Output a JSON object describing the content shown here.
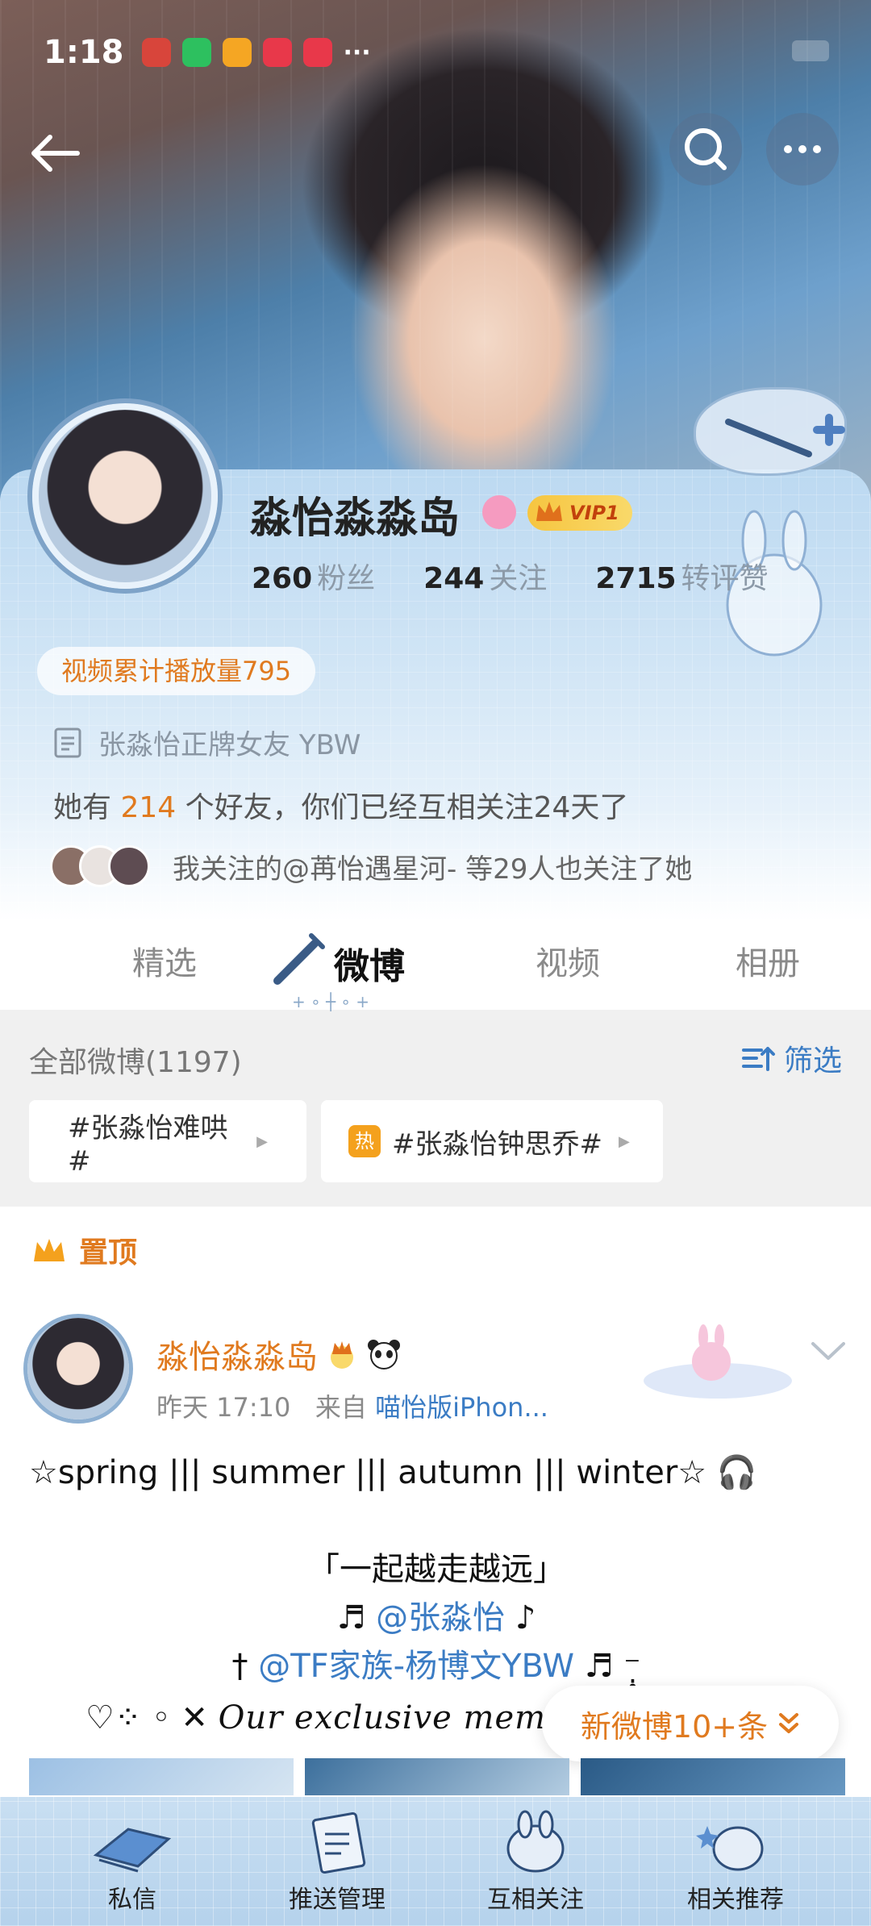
{
  "status_bar": {
    "time": "1:18",
    "more": "···"
  },
  "profile": {
    "nickname": "淼怡淼淼岛",
    "vip_label": "VIP1",
    "stats": [
      {
        "value": "260",
        "label": "粉丝"
      },
      {
        "value": "244",
        "label": "关注"
      },
      {
        "value": "2715",
        "label": "转评赞"
      }
    ],
    "play_count": "视频累计播放量795",
    "bio": "张淼怡正牌女友 YBW",
    "friends": {
      "prefix": "她有 ",
      "count": "214",
      "suffix": " 个好友，你们已经互相关注24天了"
    },
    "mutual_follow": "我关注的@苒怡遇星河- 等29人也关注了她"
  },
  "tabs": [
    "精选",
    "微博",
    "视频",
    "相册"
  ],
  "feed_header": {
    "count_label": "全部微博(1197)",
    "filter_label": "筛选"
  },
  "topics": [
    {
      "label": "#张淼怡难哄#"
    },
    {
      "label": "#张淼怡钟思乔#",
      "hot": "热"
    }
  ],
  "pinned": {
    "label": "置顶",
    "author": "淼怡淼淼岛",
    "time": "昨天 17:10",
    "from_prefix": "来自",
    "source": "喵怡版iPhon...",
    "lines": [
      "☆spring ||| summer ||| autumn ||| winter☆ 🎧",
      "「一起越走越远」",
      "♬ ",
      "@张淼怡",
      " ♪",
      "† ",
      "@TF家族-杨博文YBW",
      " ♬ ⁻̣̥",
      "♡⁘ ◦ ✕ ",
      "Our exclusive memories"
    ]
  },
  "new_posts": "新微博10+条",
  "bottom_nav": [
    "私信",
    "推送管理",
    "互相关注",
    "相关推荐"
  ],
  "colors": {
    "accent": "#e07a1f",
    "link": "#3b7cc4",
    "card": "#cfe4f5"
  }
}
